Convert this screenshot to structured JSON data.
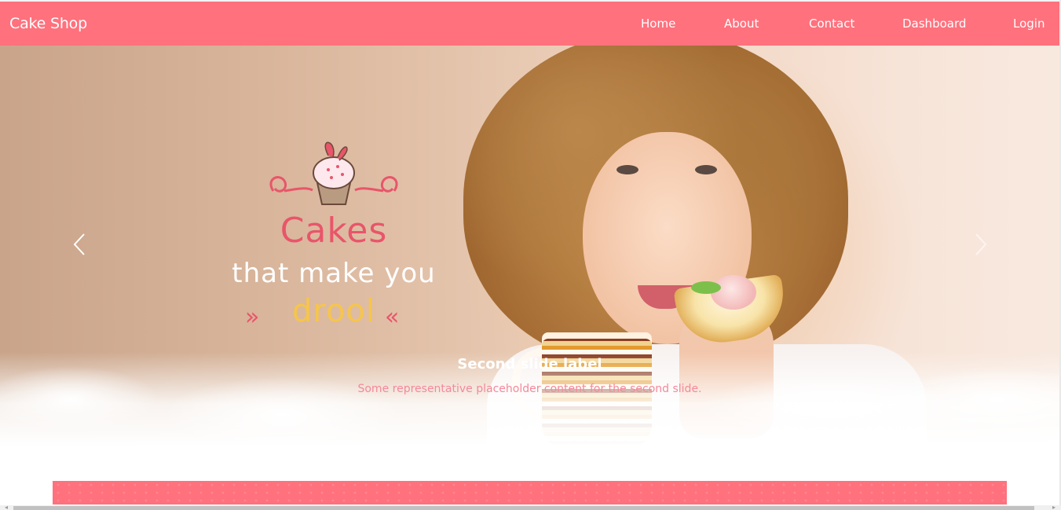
{
  "navbar": {
    "brand": "Cake Shop",
    "items": [
      {
        "label": "Home"
      },
      {
        "label": "About"
      },
      {
        "label": "Contact"
      },
      {
        "label": "Dashboard"
      },
      {
        "label": "Login"
      }
    ],
    "color": "#ff717d"
  },
  "hero": {
    "logo": {
      "line1": "Cakes",
      "line2": "that make you",
      "line3": "drool",
      "arrow_left": "»",
      "arrow_right": "«"
    },
    "caption_title": "Second slide label",
    "caption_text": "Some representative placeholder content for the second slide.",
    "prev_icon": "chevron-left-icon",
    "next_icon": "chevron-right-icon"
  },
  "section": {
    "band_color": "#ff717d"
  }
}
